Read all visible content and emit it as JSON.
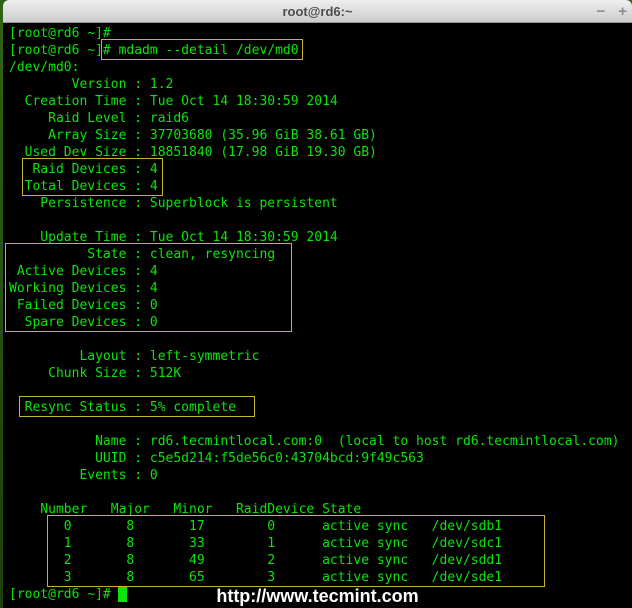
{
  "window": {
    "title": "root@rd6:~",
    "controls": [
      {
        "name": "minimize",
        "glyph": "−"
      },
      {
        "name": "maximize",
        "glyph": "+"
      }
    ]
  },
  "terminal": {
    "lines": [
      "[root@rd6 ~]# ",
      "[root@rd6 ~]# mdadm --detail /dev/md0",
      "/dev/md0:",
      "        Version : 1.2",
      "  Creation Time : Tue Oct 14 18:30:59 2014",
      "     Raid Level : raid6",
      "     Array Size : 37703680 (35.96 GiB 38.61 GB)",
      "  Used Dev Size : 18851840 (17.98 GiB 19.30 GB)",
      "   Raid Devices : 4",
      "  Total Devices : 4",
      "    Persistence : Superblock is persistent",
      "",
      "    Update Time : Tue Oct 14 18:30:59 2014",
      "          State : clean, resyncing",
      " Active Devices : 4",
      "Working Devices : 4",
      " Failed Devices : 0",
      "  Spare Devices : 0",
      "",
      "         Layout : left-symmetric",
      "     Chunk Size : 512K",
      "",
      "  Resync Status : 5% complete",
      "",
      "           Name : rd6.tecmintlocal.com:0  (local to host rd6.tecmintlocal.com)",
      "           UUID : c5e5d214:f5de56c0:43704bcd:9f49c563",
      "         Events : 0",
      "",
      "    Number   Major   Minor   RaidDevice State",
      "       0       8       17        0      active sync   /dev/sdb1",
      "       1       8       33        1      active sync   /dev/sdc1",
      "       2       8       49        2      active sync   /dev/sdd1",
      "       3       8       65        3      active sync   /dev/sde1",
      "[root@rd6 ~]# "
    ],
    "cursor": {
      "row": 33,
      "col": 14
    },
    "device_table": {
      "headers": [
        "Number",
        "Major",
        "Minor",
        "RaidDevice",
        "State"
      ],
      "rows": [
        [
          "0",
          "8",
          "17",
          "0",
          "active sync",
          "/dev/sdb1"
        ],
        [
          "1",
          "8",
          "33",
          "1",
          "active sync",
          "/dev/sdc1"
        ],
        [
          "2",
          "8",
          "49",
          "2",
          "active sync",
          "/dev/sdd1"
        ],
        [
          "3",
          "8",
          "65",
          "3",
          "active sync",
          "/dev/sde1"
        ]
      ]
    }
  },
  "highlights": [
    {
      "id": "command",
      "row": 1,
      "rows": 1,
      "col": 11.8,
      "cols": 25.8
    },
    {
      "id": "raid-total-devices",
      "row": 8,
      "rows": 2,
      "col": 1.6,
      "cols": 18.1
    },
    {
      "id": "state-devices",
      "row": 13,
      "rows": 5,
      "col": -0.5,
      "cols": 36.7
    },
    {
      "id": "resync-status",
      "row": 22,
      "rows": 1,
      "col": 1.3,
      "cols": 30.2
    },
    {
      "id": "device-table",
      "row": 29,
      "rows": 4,
      "col": 4.9,
      "cols": 63.7
    }
  ],
  "watermark": "http://www.tecmint.com",
  "colors": {
    "terminal_text": "#0be30b",
    "terminal_bg": "#000000",
    "highlight_border": "#c7b42e",
    "watermark_text": "#ffffff"
  }
}
